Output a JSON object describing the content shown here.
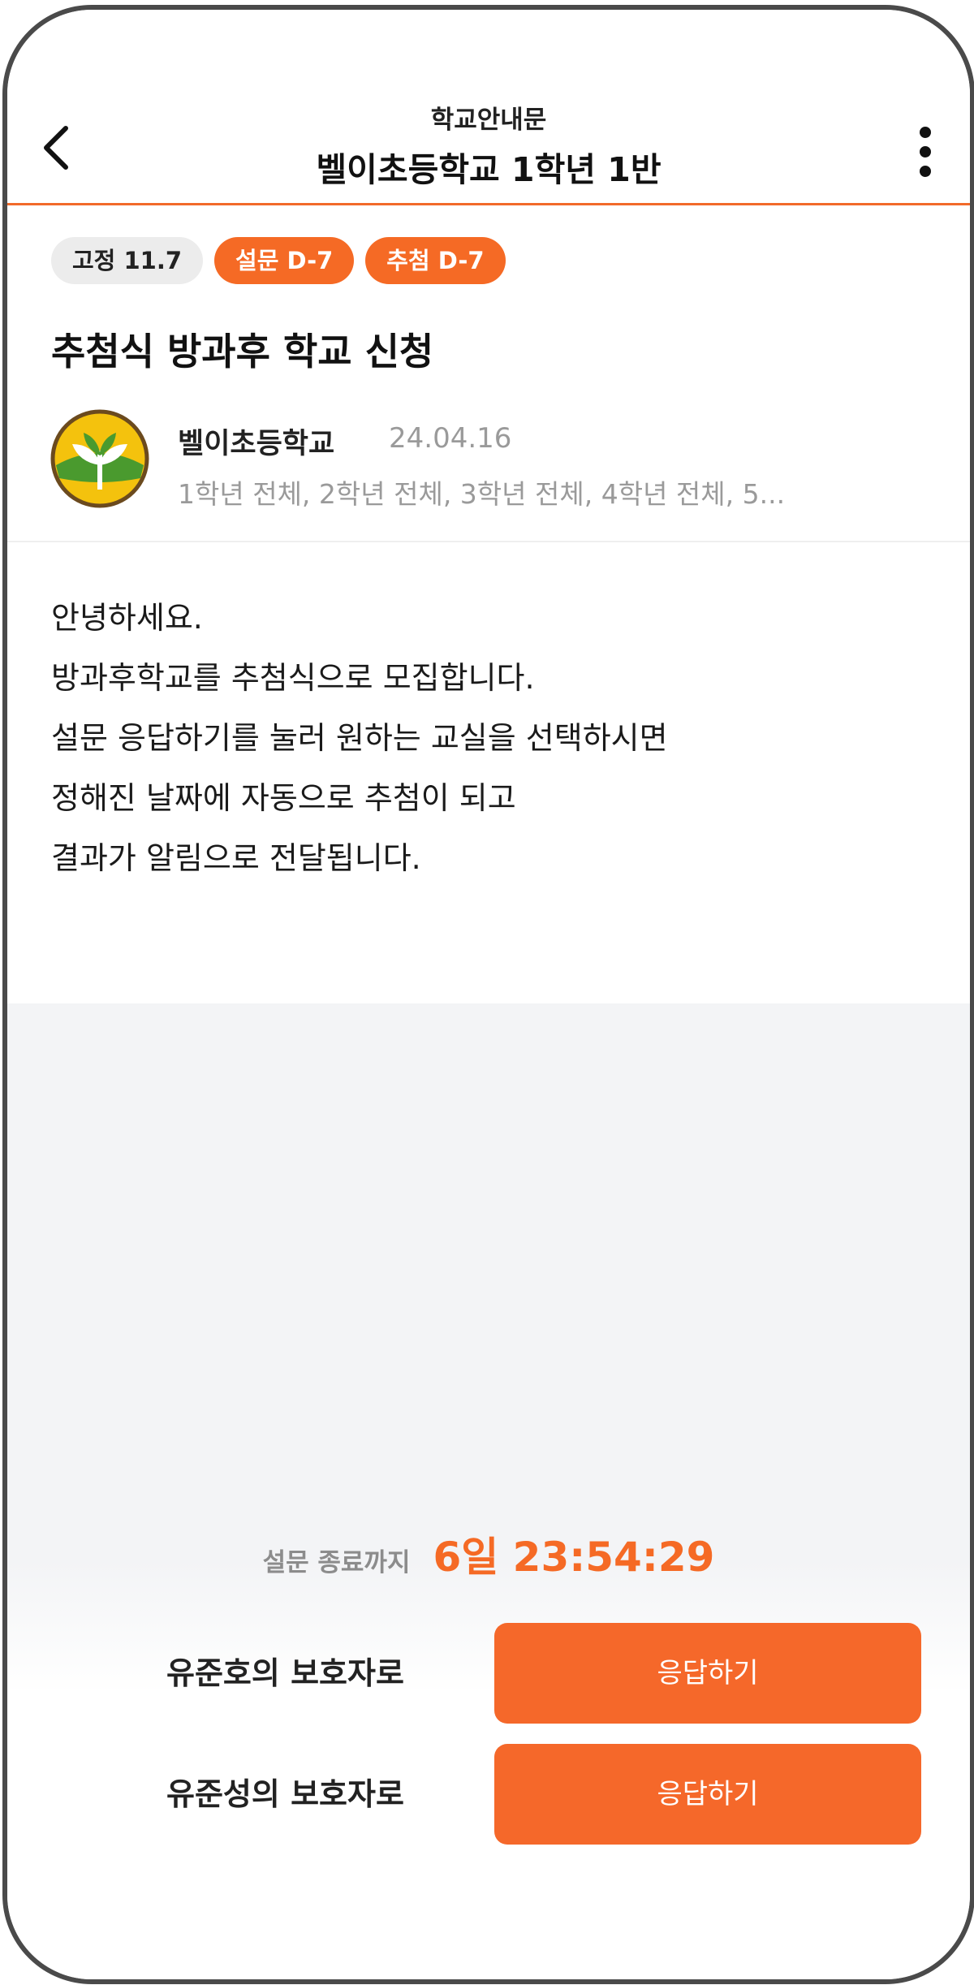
{
  "header": {
    "subtitle": "학교안내문",
    "title": "벨이초등학교 1학년 1반"
  },
  "badges": [
    {
      "label": "고정 11.7",
      "style": "gray"
    },
    {
      "label": "설문 D-7",
      "style": "orange"
    },
    {
      "label": "추첨 D-7",
      "style": "orange"
    }
  ],
  "post": {
    "title": "추첨식 방과후 학교 신청",
    "author": "벨이초등학교",
    "date": "24.04.16",
    "recipients": "1학년 전체, 2학년 전체, 3학년 전체, 4학년 전체, 5...",
    "body_lines": [
      "안녕하세요.",
      "방과후학교를 추첨식으로 모집합니다.",
      "설문 응답하기를 눌러 원하는 교실을 선택하시면",
      "정해진 날짜에 자동으로 추첨이 되고",
      "결과가 알림으로 전달됩니다."
    ]
  },
  "survey": {
    "countdown_label": "설문 종료까지",
    "countdown_value": "6일 23:54:29",
    "responders": [
      {
        "label": "유준호의 보호자로",
        "button": "응답하기"
      },
      {
        "label": "유준성의 보호자로",
        "button": "응답하기"
      }
    ]
  },
  "colors": {
    "accent": "#f56a25",
    "badge_gray": "#ececec",
    "muted_text": "#9a9a9a",
    "gray_background": "#f3f4f6"
  },
  "icons": {
    "back": "chevron-left-icon",
    "menu": "more-vertical-icon",
    "avatar": "school-logo-sprout"
  }
}
